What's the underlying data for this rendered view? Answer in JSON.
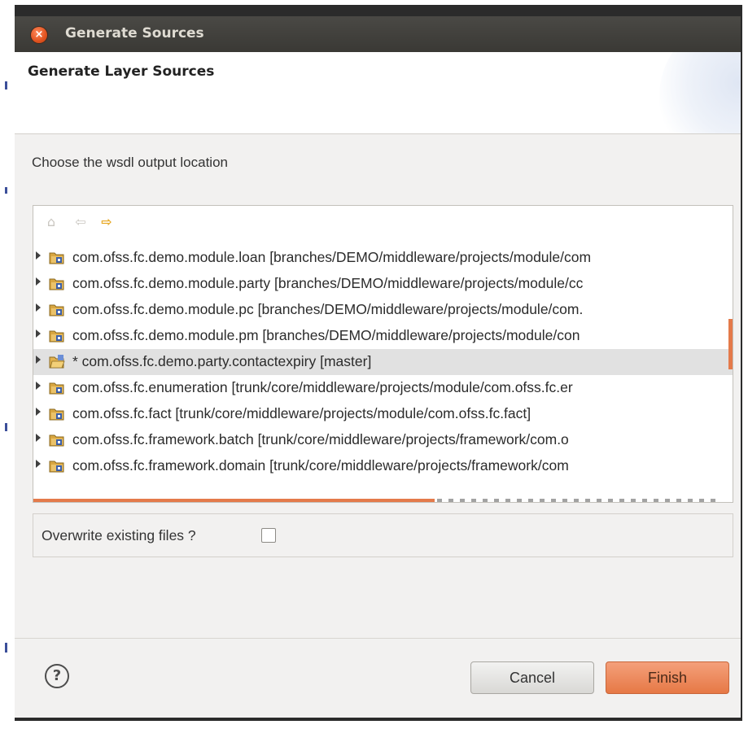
{
  "window": {
    "title": "Generate Sources"
  },
  "header": {
    "title": "Generate Layer Sources"
  },
  "description": "Choose the wsdl output location",
  "toolbar": {
    "home_icon": "home-icon",
    "back_icon": "back-arrow-icon",
    "forward_icon": "forward-arrow-icon"
  },
  "tree": {
    "items": [
      {
        "label": "com.ofss.fc.demo.module.loan [branches/DEMO/middleware/projects/module/com",
        "icon": "svn-project-icon",
        "selected": false
      },
      {
        "label": "com.ofss.fc.demo.module.party [branches/DEMO/middleware/projects/module/cc",
        "icon": "svn-project-icon",
        "selected": false
      },
      {
        "label": "com.ofss.fc.demo.module.pc [branches/DEMO/middleware/projects/module/com.",
        "icon": "svn-project-icon",
        "selected": false
      },
      {
        "label": "com.ofss.fc.demo.module.pm [branches/DEMO/middleware/projects/module/con",
        "icon": "svn-project-icon",
        "selected": false
      },
      {
        "label": "* com.ofss.fc.demo.party.contactexpiry [master]",
        "icon": "git-project-icon",
        "selected": true
      },
      {
        "label": "com.ofss.fc.enumeration [trunk/core/middleware/projects/module/com.ofss.fc.er",
        "icon": "svn-project-icon",
        "selected": false
      },
      {
        "label": "com.ofss.fc.fact [trunk/core/middleware/projects/module/com.ofss.fc.fact]",
        "icon": "svn-project-icon",
        "selected": false
      },
      {
        "label": "com.ofss.fc.framework.batch [trunk/core/middleware/projects/framework/com.o",
        "icon": "svn-project-icon",
        "selected": false
      },
      {
        "label": "com.ofss.fc.framework.domain [trunk/core/middleware/projects/framework/com",
        "icon": "svn-project-icon",
        "selected": false
      }
    ]
  },
  "options": {
    "overwrite_label": "Overwrite existing files ?",
    "overwrite_checked": false
  },
  "buttons": {
    "cancel": "Cancel",
    "finish": "Finish",
    "help": "?"
  },
  "colors": {
    "accent": "#e67845",
    "titlebar": "#3c3b37",
    "selected_row": "#e1e1e1"
  }
}
